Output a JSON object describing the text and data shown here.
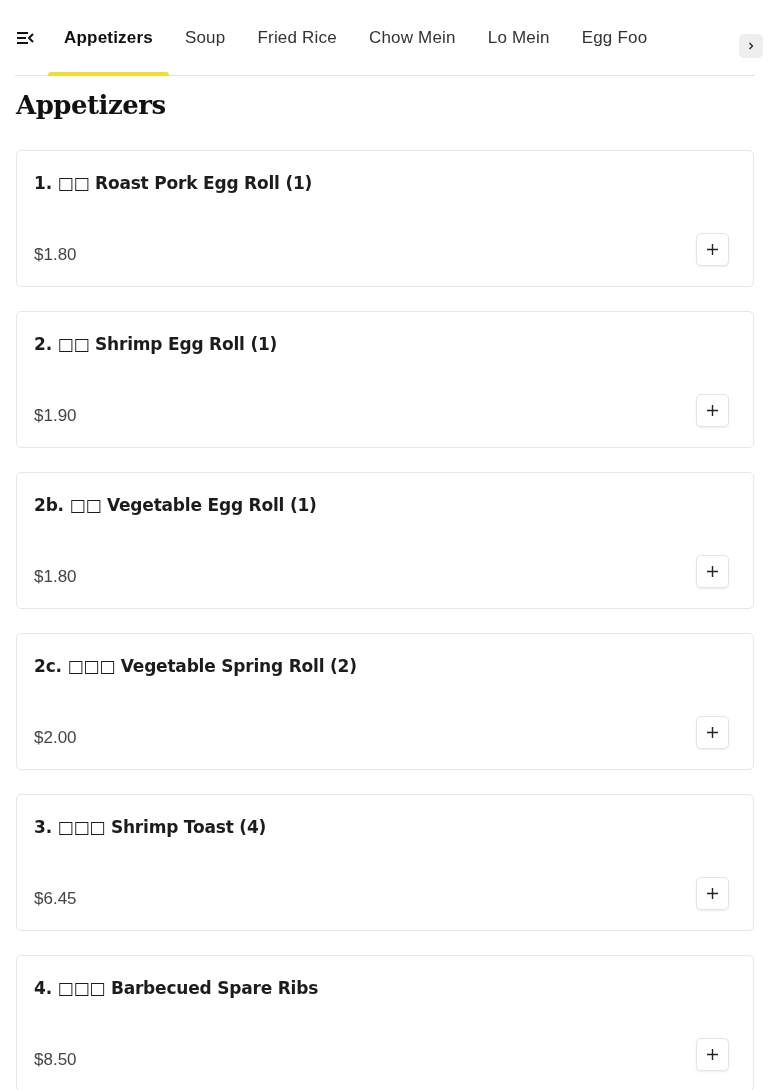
{
  "tabs": [
    {
      "label": "Appetizers",
      "selected": true
    },
    {
      "label": "Soup",
      "selected": false
    },
    {
      "label": "Fried Rice",
      "selected": false
    },
    {
      "label": "Chow Mein",
      "selected": false
    },
    {
      "label": "Lo Mein",
      "selected": false
    },
    {
      "label": "Egg Foo",
      "selected": false
    }
  ],
  "section": {
    "title": "Appetizers"
  },
  "items": [
    {
      "name": "1. □□ Roast Pork Egg Roll (1)",
      "price": "$1.80"
    },
    {
      "name": "2. □□ Shrimp Egg Roll (1)",
      "price": "$1.90"
    },
    {
      "name": "2b. □□ Vegetable Egg Roll (1)",
      "price": "$1.80"
    },
    {
      "name": "2c. □□□ Vegetable Spring Roll (2)",
      "price": "$2.00"
    },
    {
      "name": "3. □□□ Shrimp Toast (4)",
      "price": "$6.45"
    },
    {
      "name": "4. □□□ Barbecued Spare Ribs",
      "price": "$8.50"
    }
  ]
}
